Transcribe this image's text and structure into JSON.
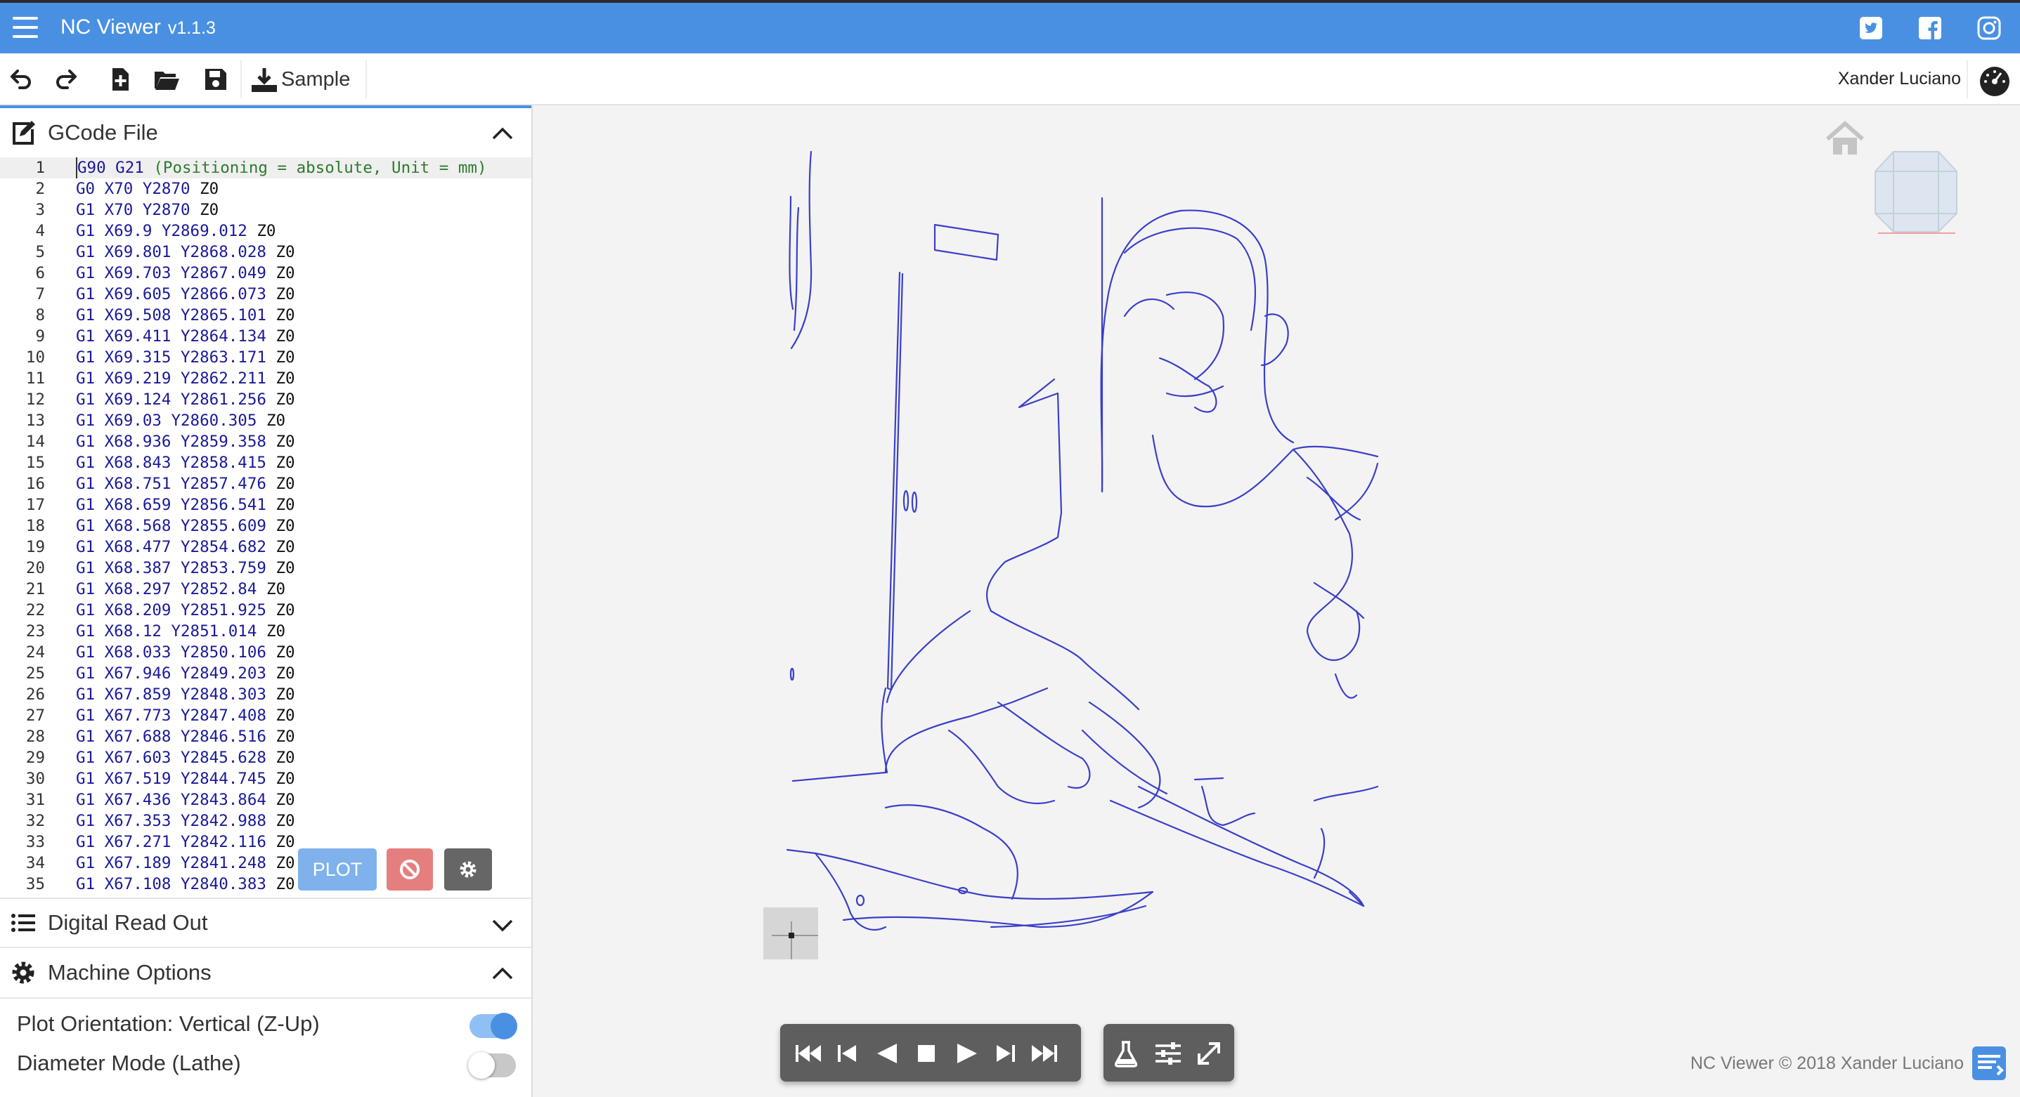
{
  "app": {
    "title": "NC Viewer",
    "version": "v1.1.3",
    "user": "Xander Luciano",
    "footer": "NC Viewer © 2018 Xander Luciano"
  },
  "colors": {
    "accent": "#4a90e2",
    "plot": "#7fb2ec",
    "stop": "#e57e7e",
    "toolpath": "#3a3fc9"
  },
  "toolbar": {
    "sample_label": "Sample"
  },
  "panels": {
    "gcode": {
      "title": "GCode File"
    },
    "dro": {
      "title": "Digital Read Out"
    },
    "machine": {
      "title": "Machine Options"
    }
  },
  "buttons": {
    "plot": "PLOT"
  },
  "options": [
    {
      "label": "Plot Orientation: Vertical (Z-Up)",
      "on": true
    },
    {
      "label": "Diameter Mode (Lathe)",
      "on": false
    }
  ],
  "gcode_lines": [
    {
      "n": "1",
      "g": "G90 G21",
      "comment": "(Positioning = absolute, Unit = mm)",
      "x": "",
      "y": "",
      "z": ""
    },
    {
      "n": "2",
      "g": "G0",
      "x": "X70",
      "y": "Y2870",
      "z": "Z0"
    },
    {
      "n": "3",
      "g": "G1",
      "x": "X70",
      "y": "Y2870",
      "z": "Z0"
    },
    {
      "n": "4",
      "g": "G1",
      "x": "X69.9",
      "y": "Y2869.012",
      "z": "Z0"
    },
    {
      "n": "5",
      "g": "G1",
      "x": "X69.801",
      "y": "Y2868.028",
      "z": "Z0"
    },
    {
      "n": "6",
      "g": "G1",
      "x": "X69.703",
      "y": "Y2867.049",
      "z": "Z0"
    },
    {
      "n": "7",
      "g": "G1",
      "x": "X69.605",
      "y": "Y2866.073",
      "z": "Z0"
    },
    {
      "n": "8",
      "g": "G1",
      "x": "X69.508",
      "y": "Y2865.101",
      "z": "Z0"
    },
    {
      "n": "9",
      "g": "G1",
      "x": "X69.411",
      "y": "Y2864.134",
      "z": "Z0"
    },
    {
      "n": "10",
      "g": "G1",
      "x": "X69.315",
      "y": "Y2863.171",
      "z": "Z0"
    },
    {
      "n": "11",
      "g": "G1",
      "x": "X69.219",
      "y": "Y2862.211",
      "z": "Z0"
    },
    {
      "n": "12",
      "g": "G1",
      "x": "X69.124",
      "y": "Y2861.256",
      "z": "Z0"
    },
    {
      "n": "13",
      "g": "G1",
      "x": "X69.03",
      "y": "Y2860.305",
      "z": "Z0"
    },
    {
      "n": "14",
      "g": "G1",
      "x": "X68.936",
      "y": "Y2859.358",
      "z": "Z0"
    },
    {
      "n": "15",
      "g": "G1",
      "x": "X68.843",
      "y": "Y2858.415",
      "z": "Z0"
    },
    {
      "n": "16",
      "g": "G1",
      "x": "X68.751",
      "y": "Y2857.476",
      "z": "Z0"
    },
    {
      "n": "17",
      "g": "G1",
      "x": "X68.659",
      "y": "Y2856.541",
      "z": "Z0"
    },
    {
      "n": "18",
      "g": "G1",
      "x": "X68.568",
      "y": "Y2855.609",
      "z": "Z0"
    },
    {
      "n": "19",
      "g": "G1",
      "x": "X68.477",
      "y": "Y2854.682",
      "z": "Z0"
    },
    {
      "n": "20",
      "g": "G1",
      "x": "X68.387",
      "y": "Y2853.759",
      "z": "Z0"
    },
    {
      "n": "21",
      "g": "G1",
      "x": "X68.297",
      "y": "Y2852.84",
      "z": "Z0"
    },
    {
      "n": "22",
      "g": "G1",
      "x": "X68.209",
      "y": "Y2851.925",
      "z": "Z0"
    },
    {
      "n": "23",
      "g": "G1",
      "x": "X68.12",
      "y": "Y2851.014",
      "z": "Z0"
    },
    {
      "n": "24",
      "g": "G1",
      "x": "X68.033",
      "y": "Y2850.106",
      "z": "Z0"
    },
    {
      "n": "25",
      "g": "G1",
      "x": "X67.946",
      "y": "Y2849.203",
      "z": "Z0"
    },
    {
      "n": "26",
      "g": "G1",
      "x": "X67.859",
      "y": "Y2848.303",
      "z": "Z0"
    },
    {
      "n": "27",
      "g": "G1",
      "x": "X67.773",
      "y": "Y2847.408",
      "z": "Z0"
    },
    {
      "n": "28",
      "g": "G1",
      "x": "X67.688",
      "y": "Y2846.516",
      "z": "Z0"
    },
    {
      "n": "29",
      "g": "G1",
      "x": "X67.603",
      "y": "Y2845.628",
      "z": "Z0"
    },
    {
      "n": "30",
      "g": "G1",
      "x": "X67.519",
      "y": "Y2844.745",
      "z": "Z0"
    },
    {
      "n": "31",
      "g": "G1",
      "x": "X67.436",
      "y": "Y2843.864",
      "z": "Z0"
    },
    {
      "n": "32",
      "g": "G1",
      "x": "X67.353",
      "y": "Y2842.988",
      "z": "Z0"
    },
    {
      "n": "33",
      "g": "G1",
      "x": "X67.271",
      "y": "Y2842.116",
      "z": "Z0"
    },
    {
      "n": "34",
      "g": "G1",
      "x": "X67.189",
      "y": "Y2841.248",
      "z": "Z0"
    },
    {
      "n": "35",
      "g": "G1",
      "x": "X67.108",
      "y": "Y2840.383",
      "z": "Z0"
    }
  ],
  "icons": {
    "menu": "hamburger-icon",
    "twitter": "twitter-icon",
    "facebook": "facebook-icon",
    "instagram": "instagram-icon",
    "undo": "undo-icon",
    "redo": "redo-icon",
    "new_file": "new-file-icon",
    "open": "folder-open-icon",
    "save": "save-icon",
    "sample": "download-icon",
    "gauge": "gauge-icon",
    "edit": "edit-icon",
    "list": "list-icon",
    "gear": "gear-icon",
    "home": "home-icon",
    "view_cube": "view-cube",
    "player": [
      "skip-start-icon",
      "step-back-icon",
      "play-reverse-icon",
      "stop-icon",
      "play-icon",
      "step-forward-icon",
      "skip-end-icon"
    ],
    "tools": [
      "flask-icon",
      "sliders-icon",
      "expand-icon"
    ]
  }
}
